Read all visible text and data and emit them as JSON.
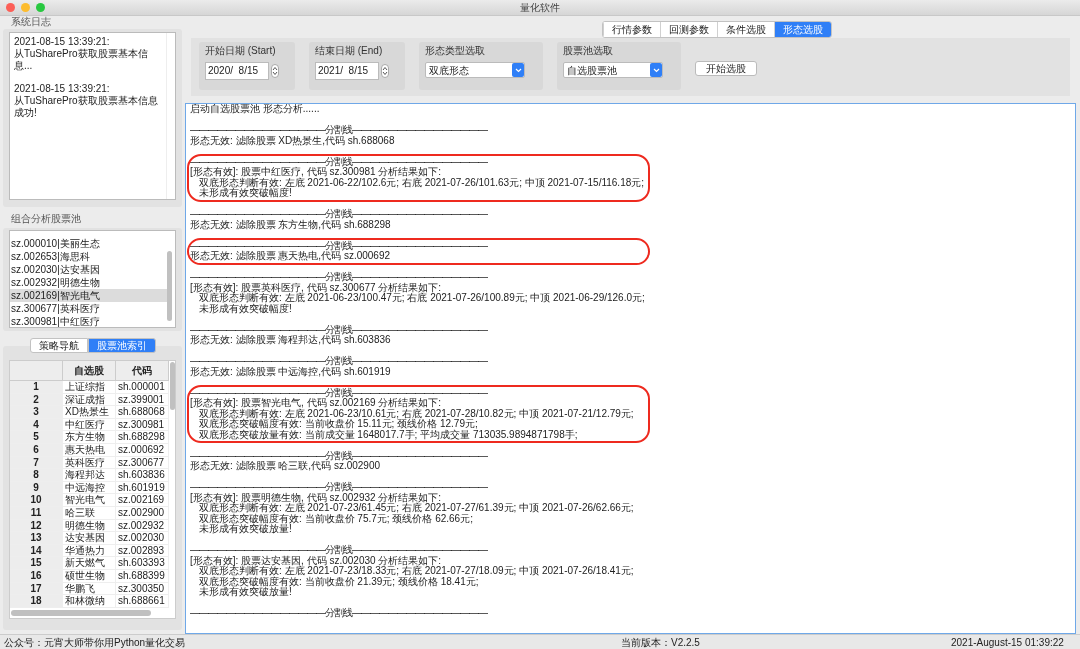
{
  "window": {
    "title": "量化软件"
  },
  "system_log": {
    "title": "系统日志",
    "entries": [
      "2021-08-15 13:39:21:\n从TuSharePro获取股票基本信息...",
      "2021-08-15 13:39:21:\n从TuSharePro获取股票基本信息成功!"
    ]
  },
  "pool": {
    "title": "组合分析股票池",
    "items": [
      {
        "label": "sz.000010|美丽生态",
        "selected": false
      },
      {
        "label": "sz.002653|海思科",
        "selected": false
      },
      {
        "label": "sz.002030|达安基因",
        "selected": false
      },
      {
        "label": "sz.002932|明德生物",
        "selected": false
      },
      {
        "label": "sz.002169|智光电气",
        "selected": true
      },
      {
        "label": "sz.300677|英科医疗",
        "selected": false
      },
      {
        "label": "sz.300981|中红医疗",
        "selected": false
      }
    ]
  },
  "nav_tabs": [
    {
      "label": "策略导航",
      "selected": false
    },
    {
      "label": "股票池索引",
      "selected": true
    }
  ],
  "table": {
    "columns": [
      "",
      "自选股",
      "代码"
    ],
    "rows": [
      [
        "1",
        "上证综指",
        "sh.000001"
      ],
      [
        "2",
        "深证成指",
        "sz.399001"
      ],
      [
        "3",
        "XD热景生",
        "sh.688068"
      ],
      [
        "4",
        "中红医疗",
        "sz.300981"
      ],
      [
        "5",
        "东方生物",
        "sh.688298"
      ],
      [
        "6",
        "惠天热电",
        "sz.000692"
      ],
      [
        "7",
        "英科医疗",
        "sz.300677"
      ],
      [
        "8",
        "海程邦达",
        "sh.603836"
      ],
      [
        "9",
        "中远海控",
        "sh.601919"
      ],
      [
        "10",
        "智光电气",
        "sz.002169"
      ],
      [
        "11",
        "哈三联",
        "sz.002900"
      ],
      [
        "12",
        "明德生物",
        "sz.002932"
      ],
      [
        "13",
        "达安基因",
        "sz.002030"
      ],
      [
        "14",
        "华通热力",
        "sz.002893"
      ],
      [
        "15",
        "新天燃气",
        "sh.603393"
      ],
      [
        "16",
        "硕世生物",
        "sh.688399"
      ],
      [
        "17",
        "华鹏飞",
        "sz.300350"
      ],
      [
        "18",
        "和林微纳",
        "sh.688661"
      ]
    ]
  },
  "tabs": [
    {
      "label": "行情参数",
      "selected": false
    },
    {
      "label": "回测参数",
      "selected": false
    },
    {
      "label": "条件选股",
      "selected": false
    },
    {
      "label": "形态选股",
      "selected": true
    }
  ],
  "controls": [
    {
      "kind": "date",
      "label": "开始日期 (Start)",
      "value": "2020/  8/15"
    },
    {
      "kind": "date",
      "label": "结束日期 (End)",
      "value": "2021/  8/15"
    },
    {
      "kind": "select",
      "label": "形态类型选取",
      "value": "双底形态"
    },
    {
      "kind": "select",
      "label": "股票池选取",
      "value": "自选股票池"
    }
  ],
  "start_button": "开始选股",
  "output": {
    "intro": "启动自选股票池 形态分析......",
    "entries": [
      {
        "separator": "———————————————分割线———————————————",
        "highlighted": false,
        "lines": [
          {
            "kind": "head",
            "text": "形态无效: 滤除股票 XD热景生,代码 sh.688068"
          }
        ]
      },
      {
        "separator": "———————————————分割线———————————————",
        "highlighted": true,
        "lines": [
          {
            "kind": "head",
            "text": "[形态有效]: 股票中红医疗, 代码 sz.300981 分析结果如下:"
          },
          {
            "kind": "detail",
            "text": "双底形态判断有效:  左底 2021-06-22/102.6元; 右底 2021-07-26/101.63元; 中顶 2021-07-15/116.18元;"
          },
          {
            "kind": "detail",
            "text": "未形成有效突破幅度!"
          }
        ]
      },
      {
        "separator": "———————————————分割线———————————————",
        "highlighted": false,
        "lines": [
          {
            "kind": "head",
            "text": "形态无效: 滤除股票 东方生物,代码 sh.688298"
          }
        ]
      },
      {
        "separator": "———————————————分割线———————————————",
        "highlighted": true,
        "lines": [
          {
            "kind": "head",
            "text": "形态无效: 滤除股票 惠天热电,代码 sz.000692"
          }
        ]
      },
      {
        "separator": "———————————————分割线———————————————",
        "highlighted": false,
        "lines": [
          {
            "kind": "head",
            "text": "[形态有效]: 股票英科医疗, 代码 sz.300677 分析结果如下:"
          },
          {
            "kind": "detail",
            "text": "双底形态判断有效:  左底 2021-06-23/100.47元; 右底 2021-07-26/100.89元; 中顶 2021-06-29/126.0元;"
          },
          {
            "kind": "detail",
            "text": "未形成有效突破幅度!"
          }
        ]
      },
      {
        "separator": "———————————————分割线———————————————",
        "highlighted": false,
        "lines": [
          {
            "kind": "head",
            "text": "形态无效: 滤除股票 海程邦达,代码 sh.603836"
          }
        ]
      },
      {
        "separator": "———————————————分割线———————————————",
        "highlighted": false,
        "lines": [
          {
            "kind": "head",
            "text": "形态无效: 滤除股票 中远海控,代码 sh.601919"
          }
        ]
      },
      {
        "separator": "———————————————分割线———————————————",
        "highlighted": true,
        "lines": [
          {
            "kind": "head",
            "text": "[形态有效]: 股票智光电气, 代码 sz.002169 分析结果如下:"
          },
          {
            "kind": "detail",
            "text": "双底形态判断有效:  左底 2021-06-23/10.61元; 右底 2021-07-28/10.82元; 中顶 2021-07-21/12.79元;"
          },
          {
            "kind": "detail",
            "text": "双底形态突破幅度有效:  当前收盘价 15.11元; 颈线价格 12.79元;"
          },
          {
            "kind": "detail",
            "text": "双底形态突破放量有效:  当前成交量 1648017.7手; 平均成交量 713035.9894871798手;"
          }
        ]
      },
      {
        "separator": "———————————————分割线———————————————",
        "highlighted": false,
        "lines": [
          {
            "kind": "head",
            "text": "形态无效: 滤除股票 哈三联,代码 sz.002900"
          }
        ]
      },
      {
        "separator": "———————————————分割线———————————————",
        "highlighted": false,
        "lines": [
          {
            "kind": "head",
            "text": "[形态有效]: 股票明德生物, 代码 sz.002932 分析结果如下:"
          },
          {
            "kind": "detail",
            "text": "双底形态判断有效:  左底 2021-07-23/61.45元; 右底 2021-07-27/61.39元; 中顶 2021-07-26/62.66元;"
          },
          {
            "kind": "detail",
            "text": "双底形态突破幅度有效:  当前收盘价 75.7元; 颈线价格 62.66元;"
          },
          {
            "kind": "detail",
            "text": "未形成有效突破放量!"
          }
        ]
      },
      {
        "separator": "———————————————分割线———————————————",
        "highlighted": false,
        "lines": [
          {
            "kind": "head",
            "text": "[形态有效]: 股票达安基因, 代码 sz.002030 分析结果如下:"
          },
          {
            "kind": "detail",
            "text": "双底形态判断有效:  左底 2021-07-23/18.33元; 右底 2021-07-27/18.09元; 中顶 2021-07-26/18.41元;"
          },
          {
            "kind": "detail",
            "text": "双底形态突破幅度有效:  当前收盘价 21.39元; 颈线价格 18.41元;"
          },
          {
            "kind": "detail",
            "text": "未形成有效突破放量!"
          }
        ]
      },
      {
        "separator": "———————————————分割线———————————————",
        "highlighted": false
      }
    ]
  },
  "status_bar": {
    "left": "公众号：元宵大师带你用Python量化交易",
    "version": "当前版本：V2.2.5",
    "time": "2021-August-15 01:39:22"
  }
}
